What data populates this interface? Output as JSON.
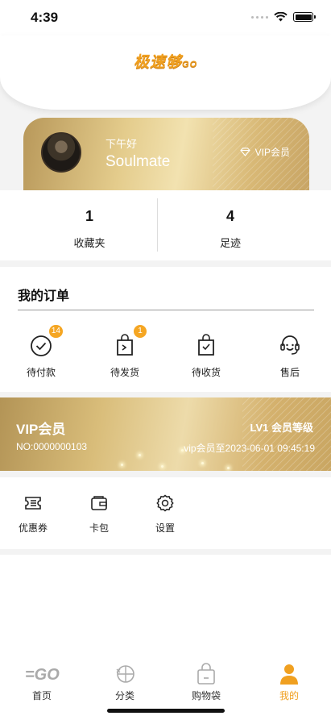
{
  "status_bar": {
    "time": "4:39"
  },
  "header": {
    "logo_text": "极速够",
    "logo_suffix": "GO"
  },
  "profile": {
    "greeting": "下午好",
    "nickname": "Soulmate",
    "vip_tag": "VIP会员"
  },
  "stats": [
    {
      "value": "1",
      "label": "收藏夹"
    },
    {
      "value": "4",
      "label": "足迹"
    }
  ],
  "orders": {
    "title": "我的订单",
    "items": [
      {
        "label": "待付款",
        "badge": "14",
        "icon": "clock-check-icon"
      },
      {
        "label": "待发货",
        "badge": "1",
        "icon": "bag-send-icon"
      },
      {
        "label": "待收货",
        "badge": "",
        "icon": "bag-receive-icon"
      },
      {
        "label": "售后",
        "badge": "",
        "icon": "headset-icon"
      }
    ]
  },
  "vip_card": {
    "title": "VIP会员",
    "number": "NO:0000000103",
    "level": "LV1 会员等级",
    "expire": "vip会员至2023-06-01 09:45:19"
  },
  "tools": [
    {
      "label": "优惠券",
      "icon": "coupon-icon"
    },
    {
      "label": "卡包",
      "icon": "wallet-icon"
    },
    {
      "label": "设置",
      "icon": "gear-icon"
    }
  ],
  "tabbar": {
    "active": "我的",
    "accent_color": "#f0a020",
    "items": [
      {
        "label": "首页",
        "icon": "home-go-icon"
      },
      {
        "label": "分类",
        "icon": "category-icon"
      },
      {
        "label": "购物袋",
        "icon": "shopping-bag-icon"
      },
      {
        "label": "我的",
        "icon": "user-icon"
      }
    ]
  }
}
